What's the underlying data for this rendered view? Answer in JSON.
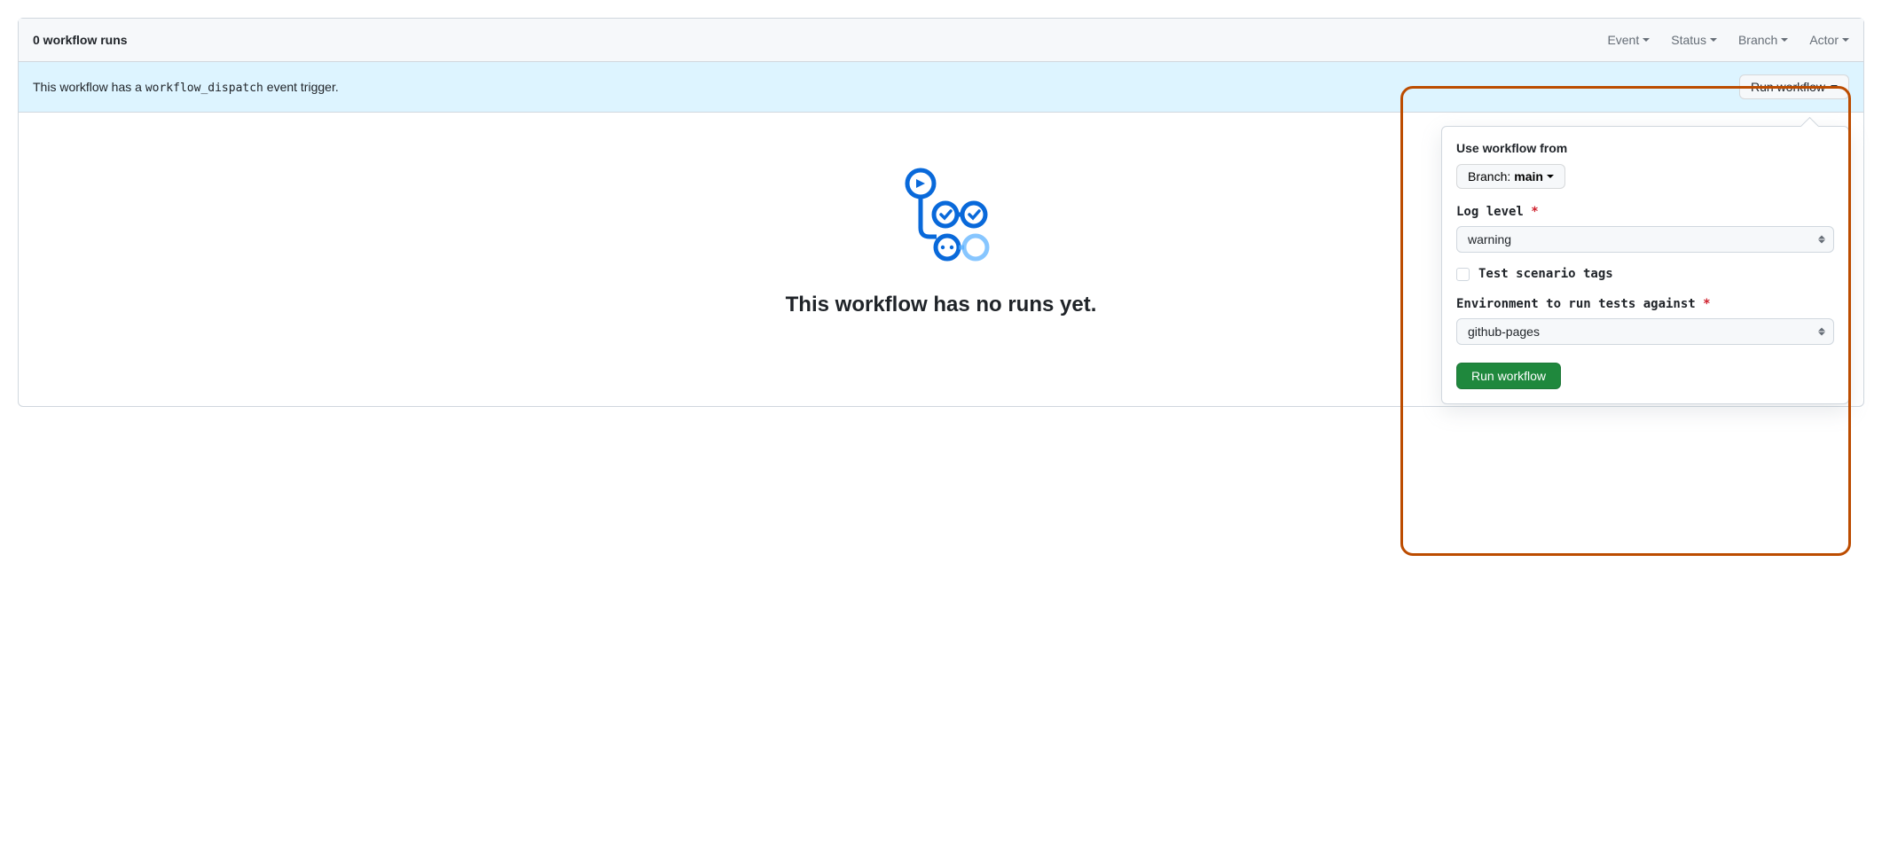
{
  "header": {
    "runs_count": "0 workflow runs",
    "filters": {
      "event": "Event",
      "status": "Status",
      "branch": "Branch",
      "actor": "Actor"
    }
  },
  "banner": {
    "text_before": "This workflow has a ",
    "code": "workflow_dispatch",
    "text_after": " event trigger.",
    "button": "Run workflow"
  },
  "empty_state": {
    "heading": "This workflow has no runs yet."
  },
  "popover": {
    "use_from_label": "Use workflow from",
    "branch_prefix": "Branch: ",
    "branch_name": "main",
    "log_level_label": "Log level",
    "log_level_value": "warning",
    "checkbox_label": "Test scenario tags",
    "env_label": "Environment to run tests against",
    "env_value": "github-pages",
    "run_button": "Run workflow"
  }
}
